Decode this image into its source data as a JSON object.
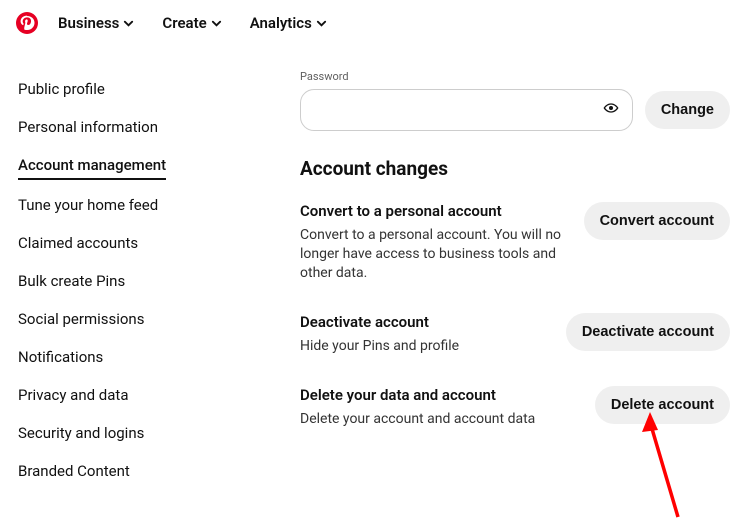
{
  "topnav": {
    "items": [
      "Business",
      "Create",
      "Analytics"
    ]
  },
  "sidebar": {
    "items": [
      "Public profile",
      "Personal information",
      "Account management",
      "Tune your home feed",
      "Claimed accounts",
      "Bulk create Pins",
      "Social permissions",
      "Notifications",
      "Privacy and data",
      "Security and logins",
      "Branded Content"
    ],
    "active_index": 2
  },
  "password": {
    "label": "Password",
    "value": "",
    "change_button": "Change"
  },
  "section_heading": "Account changes",
  "settings": [
    {
      "title": "Convert to a personal account",
      "desc": "Convert to a personal account. You will no longer have access to business tools and other data.",
      "button": "Convert account"
    },
    {
      "title": "Deactivate account",
      "desc": "Hide your Pins and profile",
      "button": "Deactivate account"
    },
    {
      "title": "Delete your data and account",
      "desc": "Delete your account and account data",
      "button": "Delete account"
    }
  ],
  "colors": {
    "brand_red": "#E60023",
    "button_bg": "#efefef",
    "arrow": "#ff0000"
  }
}
